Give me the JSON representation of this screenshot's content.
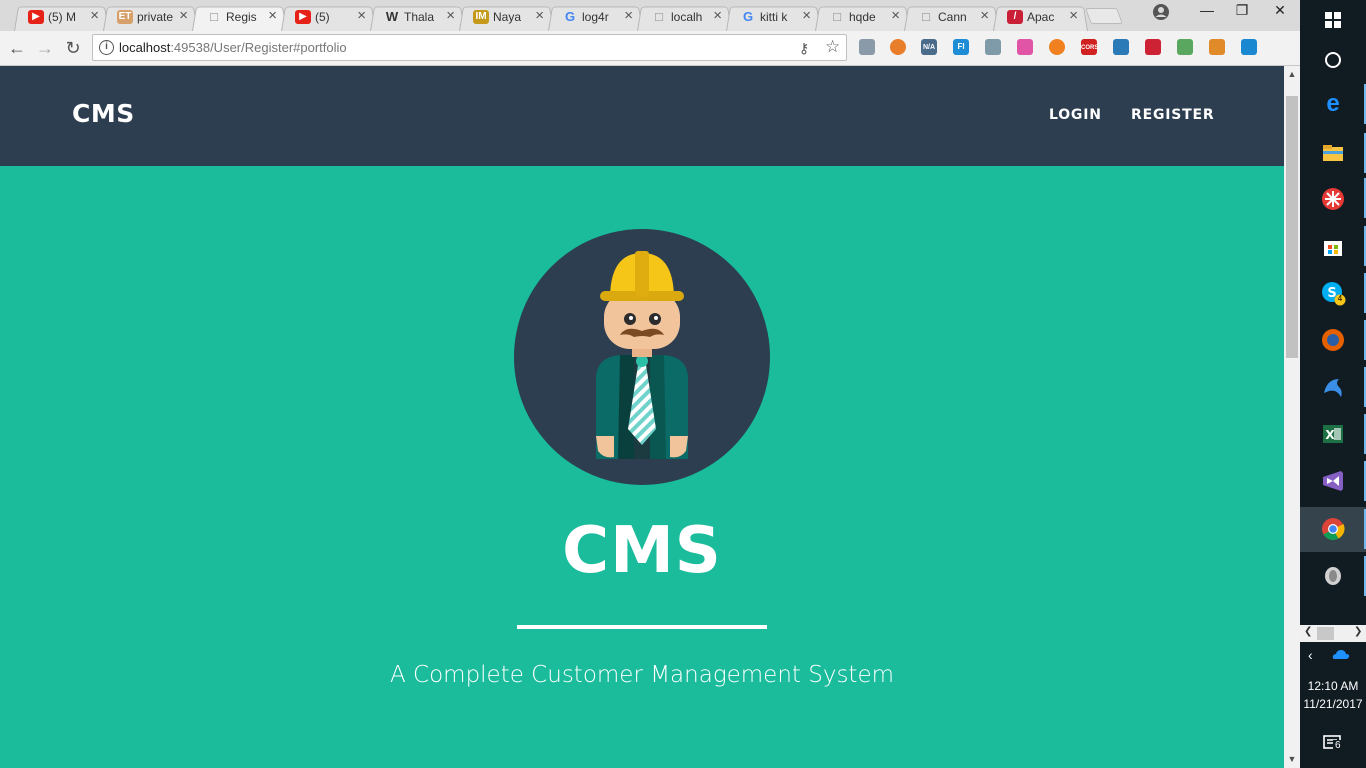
{
  "browser": {
    "tabs": [
      {
        "label": "(5) M",
        "favicon": "youtube-icon",
        "color": "#e62117"
      },
      {
        "label": "private",
        "favicon": "et-icon",
        "color": "#d7a06a"
      },
      {
        "label": "Regis",
        "favicon": "page-icon",
        "color": "#888888",
        "active": true
      },
      {
        "label": "(5)",
        "favicon": "youtube-icon",
        "color": "#e62117"
      },
      {
        "label": "Thala",
        "favicon": "wikipedia-icon",
        "color": "#333333"
      },
      {
        "label": "Naya",
        "favicon": "imdb-icon",
        "color": "#c59a1b"
      },
      {
        "label": "log4r",
        "favicon": "google-icon",
        "color": "#4285f4"
      },
      {
        "label": "localh",
        "favicon": "page-icon",
        "color": "#888888"
      },
      {
        "label": "kitti k",
        "favicon": "google-icon",
        "color": "#4285f4"
      },
      {
        "label": "hqde",
        "favicon": "page-icon",
        "color": "#888888"
      },
      {
        "label": "Cann",
        "favicon": "page-icon",
        "color": "#888888"
      },
      {
        "label": "Apac",
        "favicon": "apache-icon",
        "color": "#c92037"
      }
    ],
    "url_host": "localhost",
    "url_rest": ":49538/User/Register#portfolio",
    "extensions": [
      "ext-1",
      "ext-2",
      "ext-3",
      "ext-4",
      "ext-5",
      "ext-6",
      "ext-7",
      "ext-8",
      "ext-9",
      "ext-10",
      "ext-11",
      "ext-12",
      "ext-13"
    ],
    "extension_badges": {
      "na": "N/A",
      "cors": "CORS",
      "fi": "FI"
    }
  },
  "site": {
    "brand": "CMS",
    "nav": {
      "login": "LOGIN",
      "register": "REGISTER"
    },
    "hero": {
      "title": "CMS",
      "subtitle": "A Complete Customer Management System"
    },
    "colors": {
      "navbar": "#2c3e50",
      "hero": "#1abc9c"
    }
  },
  "taskbar": {
    "time": "12:10 AM",
    "date": "11/21/2017",
    "notifications": "6",
    "skype_badge": "4"
  }
}
